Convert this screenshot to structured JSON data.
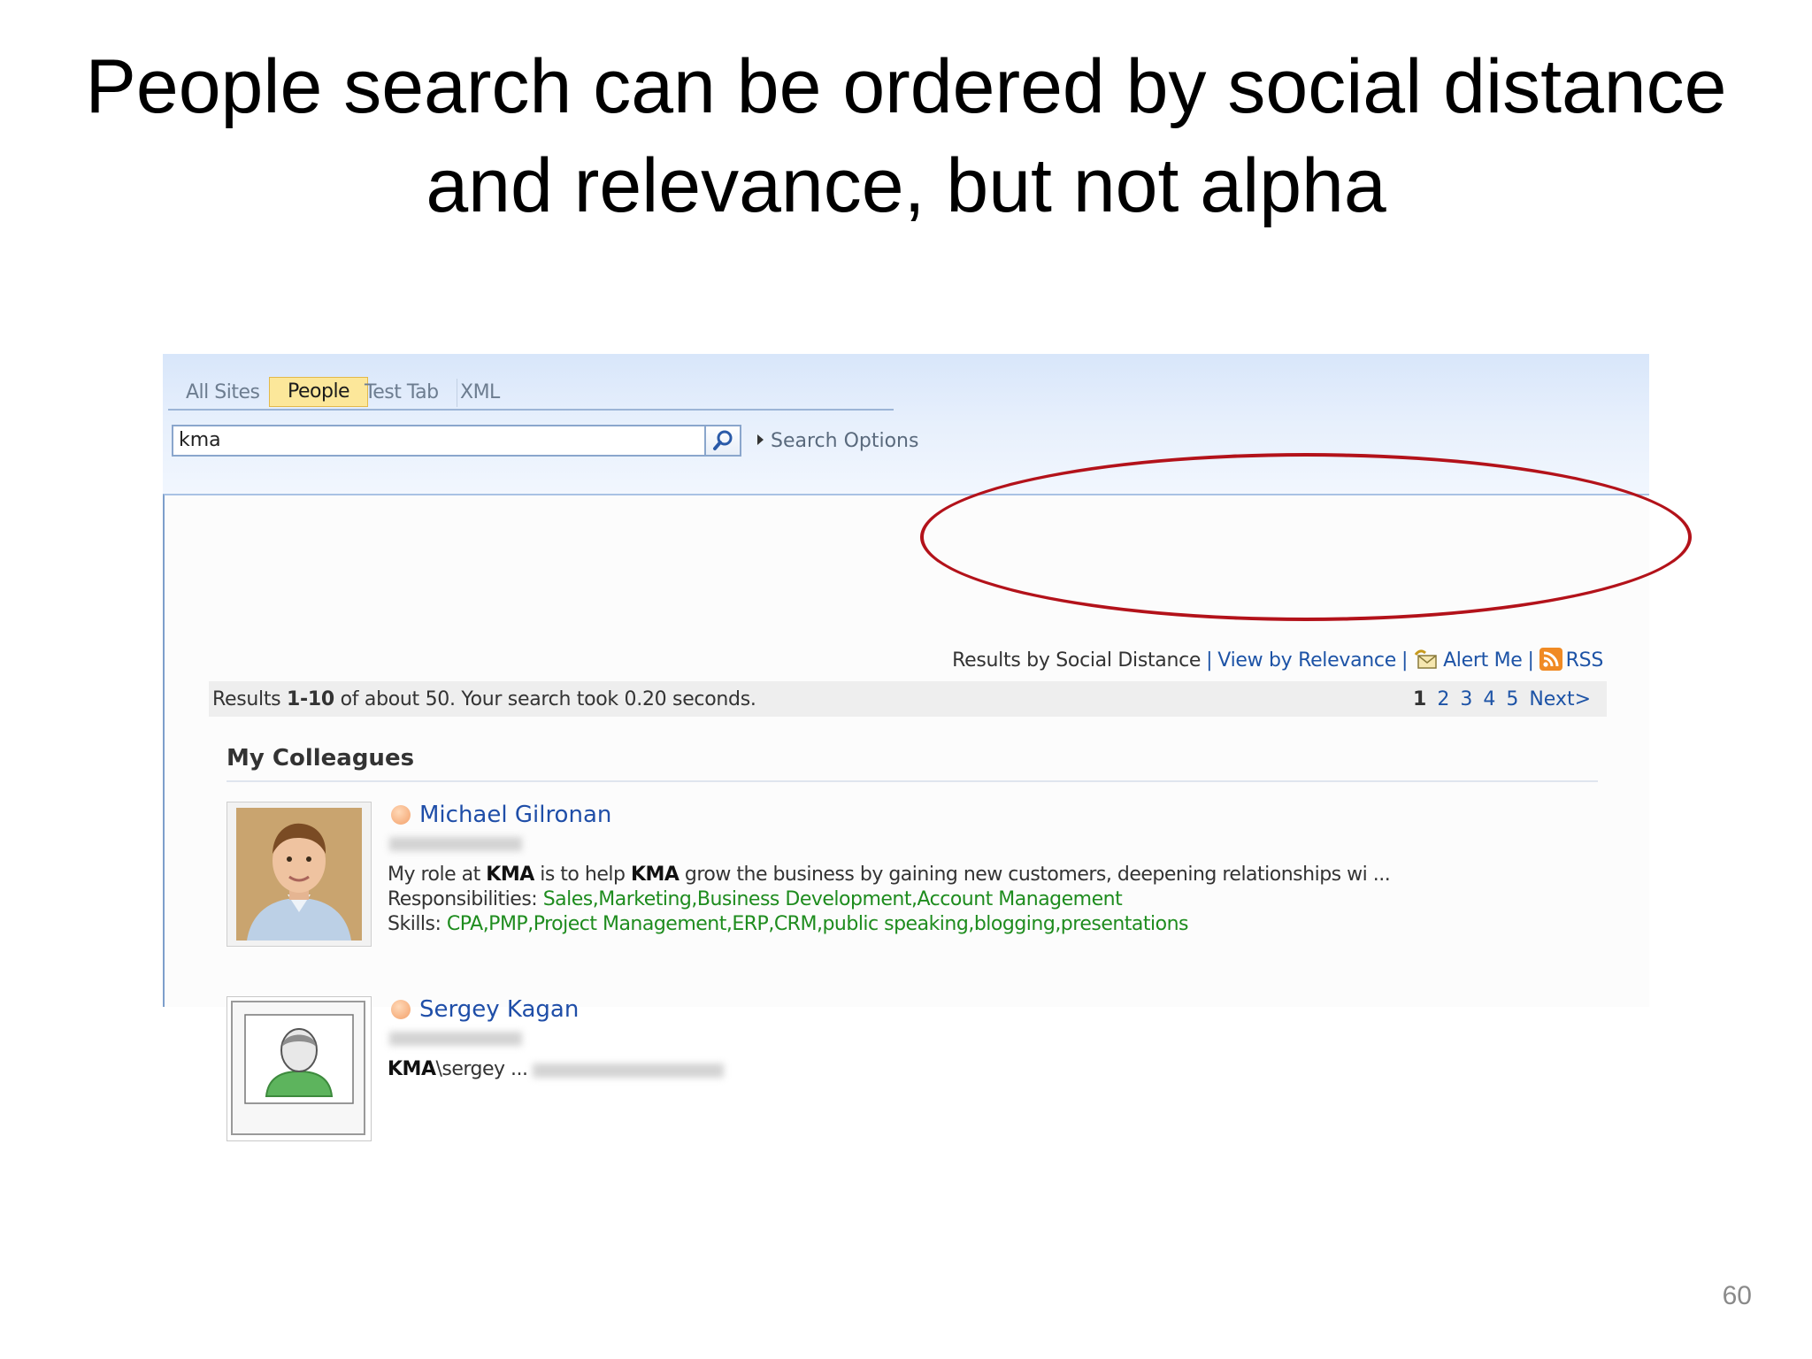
{
  "slide": {
    "title_line1": "People search can be ordered by social distance",
    "title_line2": "and relevance, but not alpha",
    "page_number": "60"
  },
  "tabs": [
    {
      "label": "All Sites",
      "active": false
    },
    {
      "label": "People",
      "active": true
    },
    {
      "label": "Test Tab",
      "active": false
    },
    {
      "label": "XML",
      "active": false
    }
  ],
  "search": {
    "query": "kma",
    "options_label": "Search Options"
  },
  "result_links": {
    "social_distance": "Results by Social Distance",
    "relevance": "View by Relevance",
    "alert_me": "Alert Me",
    "rss": "RSS"
  },
  "status": {
    "prefix": "Results ",
    "range": "1-10",
    "suffix": " of about 50. Your search took 0.20 seconds."
  },
  "pager": {
    "pages": [
      "1",
      "2",
      "3",
      "4",
      "5"
    ],
    "next": "Next>"
  },
  "section": {
    "title": "My Colleagues"
  },
  "people": [
    {
      "name": "Michael Gilronan",
      "summary_1": "My role at ",
      "summary_kma1": "KMA",
      "summary_2": " is to help ",
      "summary_kma2": "KMA",
      "summary_3": " grow the business by gaining new customers, deepening relationships wi ...",
      "responsibilities_label": "Responsibilities: ",
      "responsibilities": "Sales,Marketing,Business Development,Account Management",
      "skills_label": "Skills: ",
      "skills": "CPA,PMP,Project Management,ERP,CRM,public speaking,blogging,presentations"
    },
    {
      "name": "Sergey Kagan",
      "account_prefix": "KMA",
      "account_suffix": "\\sergey ..."
    }
  ],
  "colors": {
    "link_blue": "#1d53a6",
    "skill_green": "#1e8c1e",
    "oval_red": "#b3121a",
    "active_tab": "#fce79a"
  }
}
